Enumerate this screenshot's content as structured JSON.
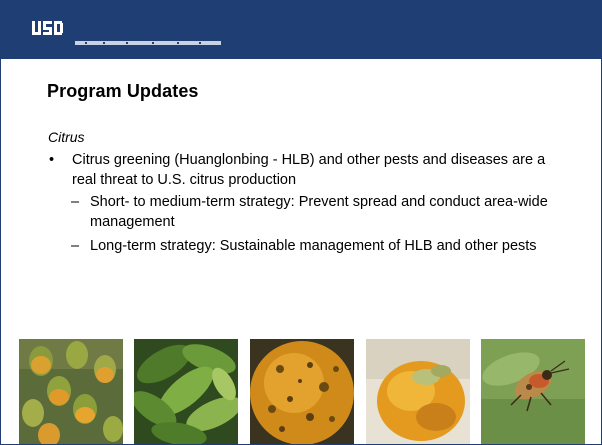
{
  "slide": {
    "title": "Program Updates",
    "section": "Citrus",
    "bullet_marker": "•",
    "sub_marker": "–",
    "bullets": [
      {
        "text": "Citrus greening (Huanglonbing - HLB) and other pests and diseases are a real threat to U.S. citrus production",
        "subs": [
          "Short- to medium-term strategy: Prevent spread and conduct area-wide management",
          "Long-term strategy: Sustainable management of HLB and other pests"
        ]
      }
    ]
  },
  "colors": {
    "banner": "#1f3e73",
    "text": "#000000",
    "background": "#ffffff"
  }
}
